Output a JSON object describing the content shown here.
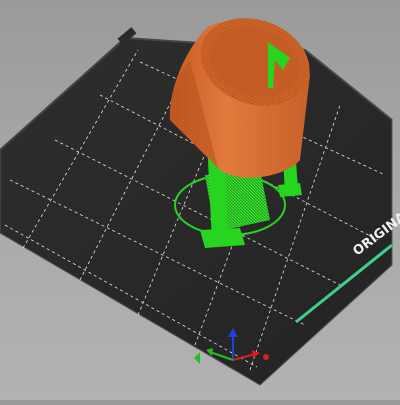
{
  "viewport": {
    "bed_brand_label": "ORIGINAL",
    "colors": {
      "background": "#a6a6a6",
      "bed": "#2b2b2b",
      "bed_edge": "#3a3a3a",
      "grid": "#e8e8e8",
      "model": "#d9672c",
      "model_dark": "#b4521f",
      "support": "#27d41f",
      "axis_x": "#d42020",
      "axis_y": "#20c020",
      "axis_z": "#2040e0"
    },
    "axes": {
      "x_label": "",
      "y_label": "",
      "z_label": ""
    }
  }
}
